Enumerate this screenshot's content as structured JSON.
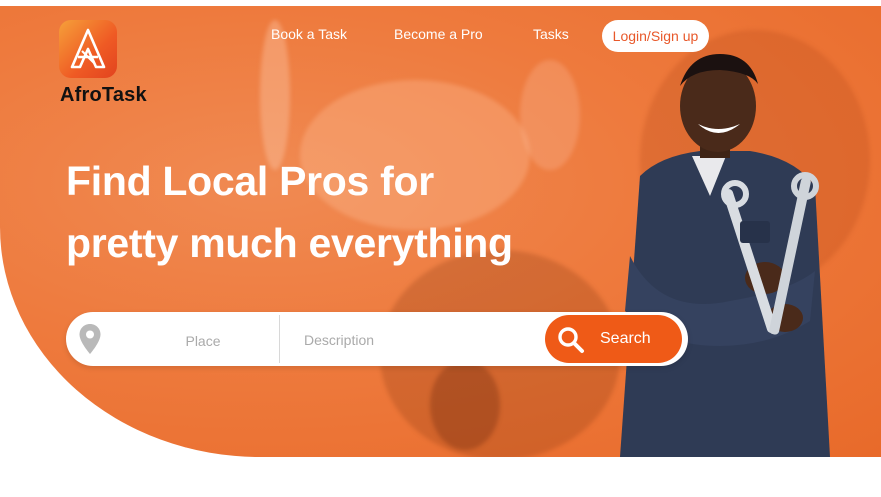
{
  "brand": {
    "name": "AfroTask",
    "accent": "#ef5a17",
    "hero_bg": "#ee7a3d"
  },
  "nav": {
    "items": [
      {
        "label": "Book a Task"
      },
      {
        "label": "Become a Pro"
      },
      {
        "label": "Tasks"
      }
    ],
    "login_label": "Login/Sign up"
  },
  "hero": {
    "headline_line1": "Find Local Pros for",
    "headline_line2": "pretty much everything"
  },
  "search": {
    "place_placeholder": "Place",
    "description_placeholder": "Description",
    "button_label": "Search",
    "place_icon": "location-pin-icon",
    "button_icon": "magnifier-icon"
  }
}
